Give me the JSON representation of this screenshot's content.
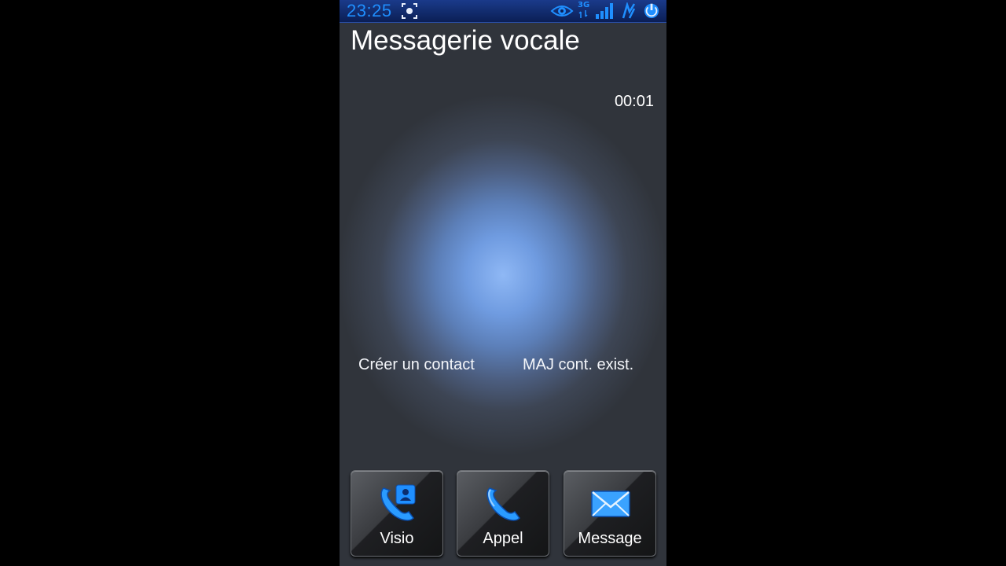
{
  "status_bar": {
    "time": "23:25",
    "network_label": "3G",
    "icons": [
      "screenshot-icon",
      "eye-icon",
      "network-3g-icon",
      "signal-strength-icon",
      "sync-icon",
      "power-icon"
    ]
  },
  "header": {
    "title": "Messagerie vocale"
  },
  "call": {
    "timer": "00:01"
  },
  "links": {
    "create_contact": "Créer un contact",
    "update_contact": "MAJ cont. exist."
  },
  "actions": [
    {
      "label": "Visio",
      "icon": "video-call-icon"
    },
    {
      "label": "Appel",
      "icon": "phone-icon"
    },
    {
      "label": "Message",
      "icon": "envelope-icon"
    }
  ],
  "colors": {
    "accent": "#1f8fff",
    "status_bar": "#0b1f55",
    "glow": "#8fb8f5"
  }
}
